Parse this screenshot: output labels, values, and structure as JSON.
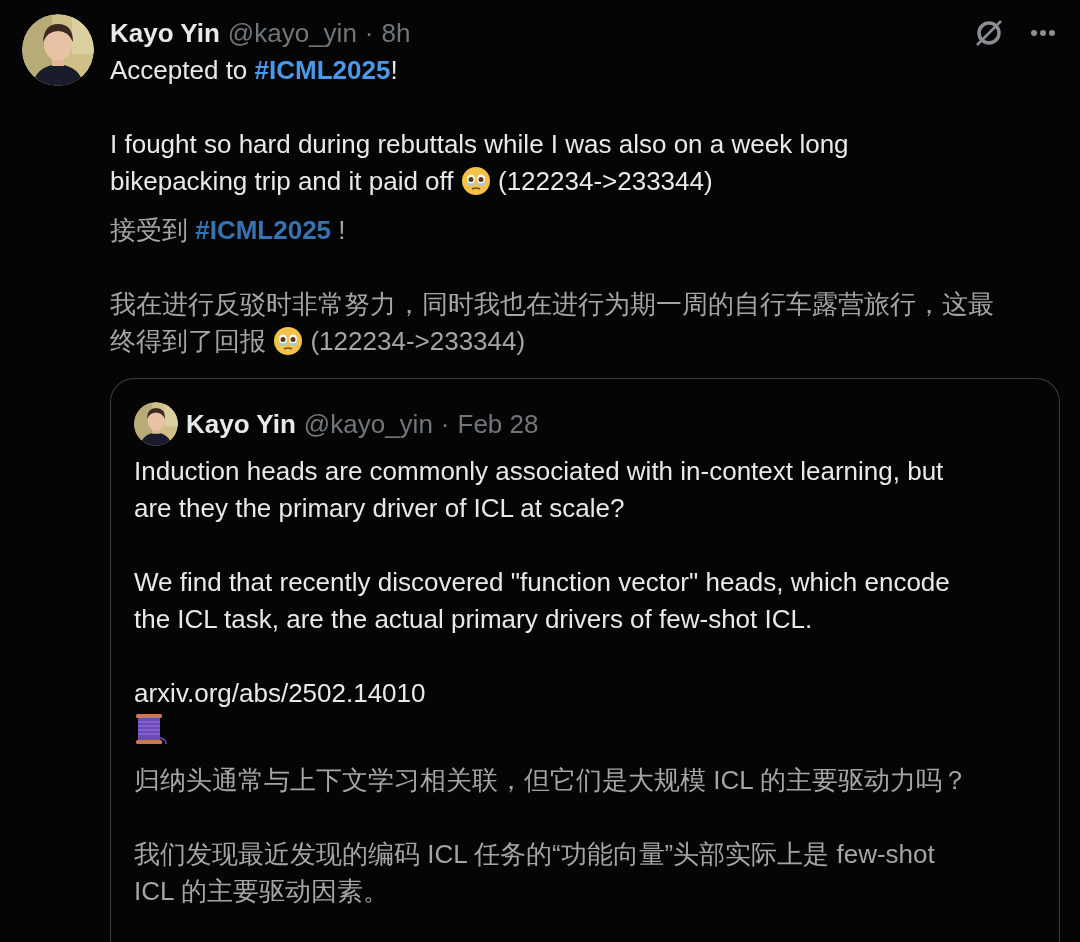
{
  "tweet": {
    "author": {
      "name": "Kayo Yin",
      "handle": "@kayo_yin",
      "separator": "·",
      "time": "8h"
    },
    "paragraphs": [
      {
        "kind": "original",
        "lines": [
          [
            {
              "kind": "text",
              "text": "Accepted to "
            },
            {
              "kind": "hashtag",
              "text": "#ICML2025"
            },
            {
              "kind": "text",
              "text": "!"
            }
          ]
        ]
      },
      {
        "kind": "original",
        "lines": [
          [
            {
              "kind": "text",
              "text": "I fought so hard during rebuttals while I was also on a week long"
            }
          ],
          [
            {
              "kind": "text",
              "text": "bikepacking trip and it paid off "
            },
            {
              "kind": "tears"
            },
            {
              "kind": "text",
              "text": " (122234->233344)"
            }
          ]
        ]
      },
      {
        "kind": "translation",
        "lines": [
          [
            {
              "kind": "text",
              "text": "接受到 "
            },
            {
              "kind": "hashtag",
              "text": "#ICML2025"
            },
            {
              "kind": "text",
              "text": " !"
            }
          ]
        ]
      },
      {
        "kind": "translation",
        "lines": [
          [
            {
              "kind": "text",
              "text": "我在进行反驳时非常努力，同时我也在进行为期一周的自行车露营旅行，这最"
            }
          ],
          [
            {
              "kind": "text",
              "text": "终得到了回报 "
            },
            {
              "kind": "tears"
            },
            {
              "kind": "text",
              "text": " (122234->233344)"
            }
          ]
        ]
      }
    ],
    "quote": {
      "author": {
        "name": "Kayo Yin",
        "handle": "@kayo_yin",
        "separator": "·",
        "time": "Feb 28"
      },
      "paragraphs": [
        {
          "kind": "original",
          "lines": [
            [
              {
                "kind": "text",
                "text": "Induction heads are commonly associated with in-context learning, but"
              }
            ],
            [
              {
                "kind": "text",
                "text": "are they the primary driver of ICL at scale?"
              }
            ]
          ]
        },
        {
          "kind": "original",
          "lines": [
            [
              {
                "kind": "text",
                "text": "We find that recently discovered \"function vector\" heads, which encode"
              }
            ],
            [
              {
                "kind": "text",
                "text": "the ICL task, are the actual primary drivers of few-shot ICL."
              }
            ]
          ]
        },
        {
          "kind": "original",
          "lines": [
            [
              {
                "kind": "link",
                "text": "arxiv.org/abs/2502.14010"
              }
            ],
            [
              {
                "kind": "thread"
              }
            ]
          ]
        },
        {
          "kind": "translation",
          "lines": [
            [
              {
                "kind": "text",
                "text": "归纳头通常与上下文学习相关联，但它们是大规模 ICL 的主要驱动力吗？"
              }
            ]
          ]
        },
        {
          "kind": "translation",
          "lines": [
            [
              {
                "kind": "text",
                "text": "我们发现最近发现的编码 ICL 任务的“功能向量”头部实际上是 few-shot"
              }
            ],
            [
              {
                "kind": "text",
                "text": "ICL 的主要驱动因素。"
              }
            ]
          ]
        }
      ]
    }
  }
}
